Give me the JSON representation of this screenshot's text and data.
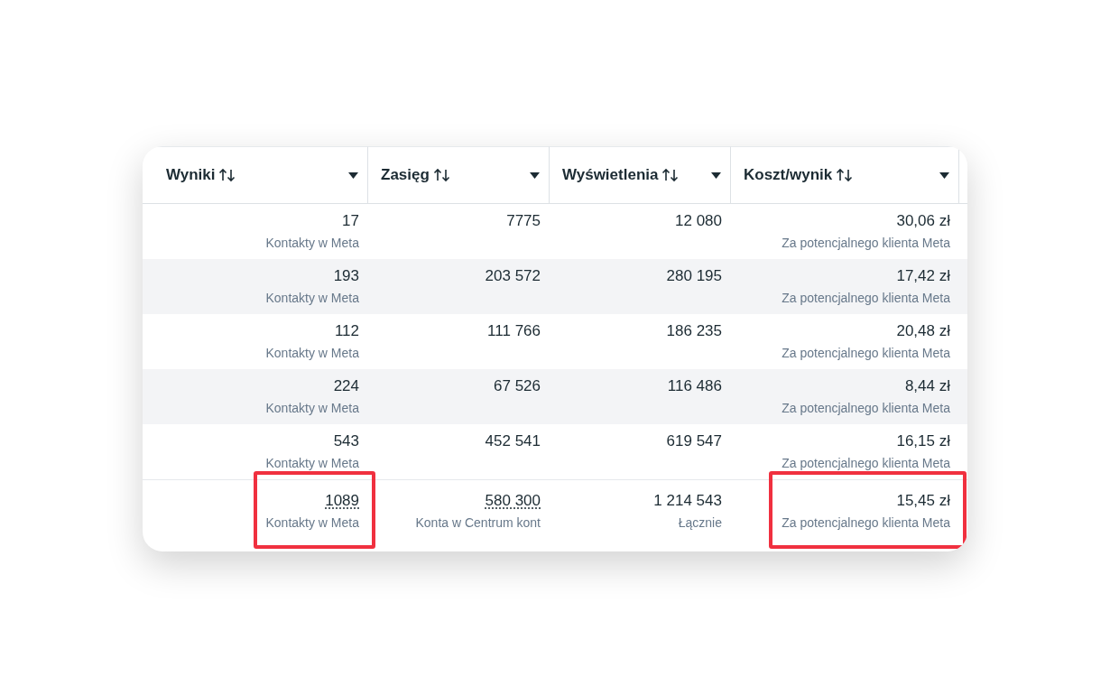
{
  "table": {
    "columns": [
      {
        "label": "Wyniki"
      },
      {
        "label": "Zasięg"
      },
      {
        "label": "Wyświetlenia"
      },
      {
        "label": "Koszt/wynik"
      }
    ],
    "rows": [
      {
        "cells": [
          {
            "value": "17",
            "sub": "Kontakty w Meta"
          },
          {
            "value": "7775"
          },
          {
            "value": "12 080"
          },
          {
            "value": "30,06 zł",
            "sub": "Za potencjalnego klienta Meta"
          }
        ]
      },
      {
        "cells": [
          {
            "value": "193",
            "sub": "Kontakty w Meta"
          },
          {
            "value": "203 572"
          },
          {
            "value": "280 195"
          },
          {
            "value": "17,42 zł",
            "sub": "Za potencjalnego klienta Meta"
          }
        ]
      },
      {
        "cells": [
          {
            "value": "112",
            "sub": "Kontakty w Meta"
          },
          {
            "value": "111 766"
          },
          {
            "value": "186 235"
          },
          {
            "value": "20,48 zł",
            "sub": "Za potencjalnego klienta Meta"
          }
        ]
      },
      {
        "cells": [
          {
            "value": "224",
            "sub": "Kontakty w Meta"
          },
          {
            "value": "67 526"
          },
          {
            "value": "116 486"
          },
          {
            "value": "8,44 zł",
            "sub": "Za potencjalnego klienta Meta"
          }
        ]
      },
      {
        "cells": [
          {
            "value": "543",
            "sub": "Kontakty w Meta"
          },
          {
            "value": "452 541"
          },
          {
            "value": "619 547"
          },
          {
            "value": "16,15 zł",
            "sub": "Za potencjalnego klienta Meta"
          }
        ]
      }
    ],
    "totals": [
      {
        "value": "1089",
        "sub": "Kontakty w Meta",
        "dotted_underline": true,
        "highlighted": true
      },
      {
        "value": "580 300",
        "sub": "Konta w Centrum kont",
        "dotted_underline": true,
        "highlighted": false
      },
      {
        "value": "1 214 543",
        "sub": "Łącznie",
        "dotted_underline": false,
        "highlighted": false
      },
      {
        "value": "15,45 zł",
        "sub": "Za potencjalnego klienta Meta",
        "dotted_underline": false,
        "highlighted": true
      }
    ]
  }
}
